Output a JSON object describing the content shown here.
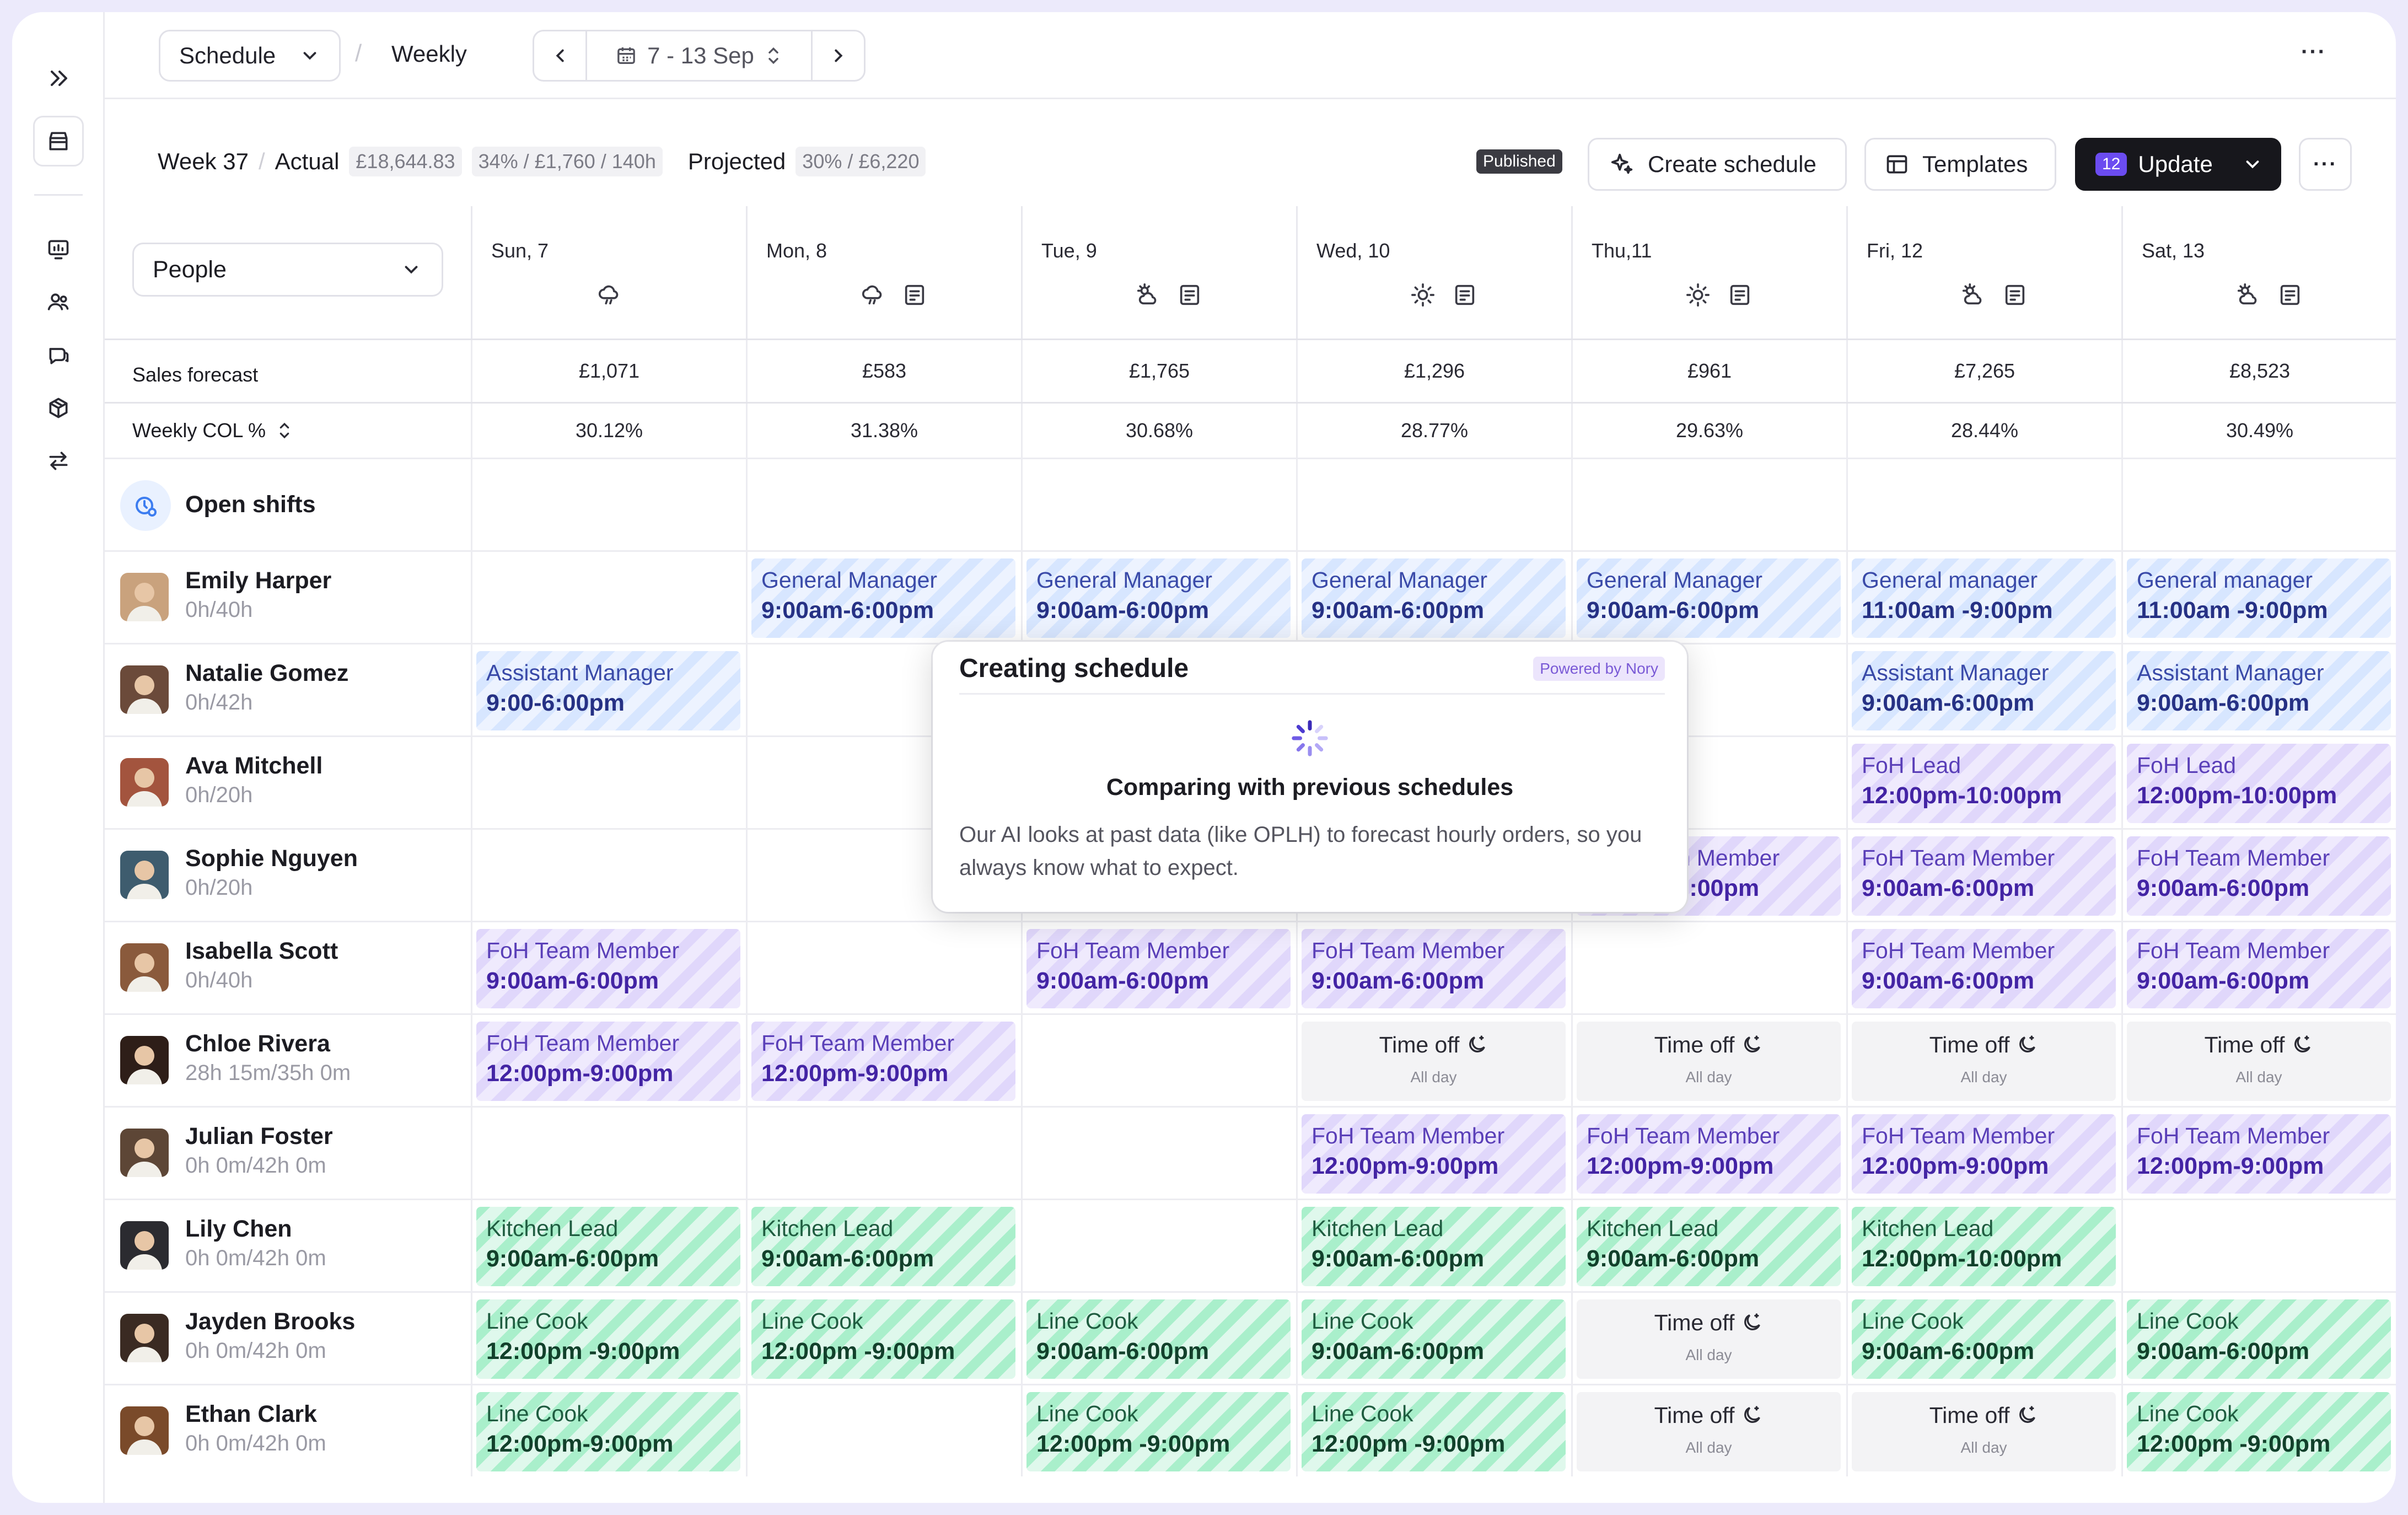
{
  "toolbar": {
    "schedule_label": "Schedule",
    "view_label": "Weekly",
    "date_range": "7 - 13 Sep",
    "more_label": "···"
  },
  "summary": {
    "week": "Week 37",
    "actual_label": "Actual",
    "actual_amount": "£18,644.83",
    "actual_stats": "34% / £1,760 / 140h",
    "projected_label": "Projected",
    "projected_stats": "30% / £6,220",
    "status_badge": "Published",
    "create_label": "Create schedule",
    "templates_label": "Templates",
    "update_count": "12",
    "update_label": "Update",
    "more_label": "···"
  },
  "filter": {
    "selected": "People"
  },
  "days": [
    {
      "label": "Sun, 7",
      "icons": [
        "cloud-rain-icon"
      ]
    },
    {
      "label": "Mon, 8",
      "icons": [
        "cloud-rain-icon",
        "note-icon"
      ]
    },
    {
      "label": "Tue, 9",
      "icons": [
        "cloud-sun-icon",
        "note-icon"
      ]
    },
    {
      "label": "Wed, 10",
      "icons": [
        "sun-icon",
        "note-icon"
      ]
    },
    {
      "label": "Thu,11",
      "icons": [
        "sun-icon",
        "note-icon"
      ]
    },
    {
      "label": "Fri, 12",
      "icons": [
        "cloud-sun-icon",
        "note-icon"
      ]
    },
    {
      "label": "Sat, 13",
      "icons": [
        "cloud-sun-icon",
        "note-icon"
      ]
    }
  ],
  "metrics": {
    "sales_label": "Sales forecast",
    "sales": [
      "£1,071",
      "£583",
      "£1,765",
      "£1,296",
      "£961",
      "£7,265",
      "£8,523"
    ],
    "col_label": "Weekly COL %",
    "col": [
      "30.12%",
      "31.38%",
      "30.68%",
      "28.77%",
      "29.63%",
      "28.44%",
      "30.49%"
    ]
  },
  "open_shifts_label": "Open shifts",
  "people": [
    {
      "name": "Emily Harper",
      "hours": "0h/40h",
      "avatar_color": "#c9a27d",
      "shifts": [
        null,
        {
          "type": "blue",
          "role": "General Manager",
          "time": "9:00am-6:00pm"
        },
        {
          "type": "blue",
          "role": "General Manager",
          "time": "9:00am-6:00pm"
        },
        {
          "type": "blue",
          "role": "General Manager",
          "time": "9:00am-6:00pm"
        },
        {
          "type": "blue",
          "role": "General Manager",
          "time": "9:00am-6:00pm"
        },
        {
          "type": "blue",
          "role": "General manager",
          "time": "11:00am -9:00pm"
        },
        {
          "type": "blue",
          "role": "General manager",
          "time": "11:00am -9:00pm"
        }
      ]
    },
    {
      "name": "Natalie Gomez",
      "hours": "0h/42h",
      "avatar_color": "#6b4a3a",
      "shifts": [
        {
          "type": "blue",
          "role": "Assistant Manager",
          "time": "9:00-6:00pm"
        },
        null,
        null,
        null,
        null,
        {
          "type": "blue",
          "role": "Assistant Manager",
          "time": "9:00am-6:00pm"
        },
        {
          "type": "blue",
          "role": "Assistant Manager",
          "time": "9:00am-6:00pm"
        }
      ]
    },
    {
      "name": "Ava Mitchell",
      "hours": "0h/20h",
      "avatar_color": "#a3543e",
      "shifts": [
        null,
        null,
        null,
        null,
        null,
        {
          "type": "purple",
          "role": "FoH Lead",
          "time": "12:00pm-10:00pm"
        },
        {
          "type": "purple",
          "role": "FoH Lead",
          "time": "12:00pm-10:00pm"
        }
      ]
    },
    {
      "name": "Sophie Nguyen",
      "hours": "0h/20h",
      "avatar_color": "#3e5c6e",
      "shifts": [
        null,
        null,
        null,
        null,
        {
          "type": "purple",
          "role": "FoH Team Member",
          "time": "9:00am-6:00pm"
        },
        {
          "type": "purple",
          "role": "FoH Team Member",
          "time": "9:00am-6:00pm"
        },
        {
          "type": "purple",
          "role": "FoH Team Member",
          "time": "9:00am-6:00pm"
        }
      ]
    },
    {
      "name": "Isabella Scott",
      "hours": "0h/40h",
      "avatar_color": "#8a5a3c",
      "shifts": [
        {
          "type": "purple",
          "role": "FoH Team Member",
          "time": "9:00am-6:00pm"
        },
        null,
        {
          "type": "purple",
          "role": "FoH Team Member",
          "time": "9:00am-6:00pm"
        },
        {
          "type": "purple",
          "role": "FoH Team Member",
          "time": "9:00am-6:00pm"
        },
        null,
        {
          "type": "purple",
          "role": "FoH Team Member",
          "time": "9:00am-6:00pm"
        },
        {
          "type": "purple",
          "role": "FoH Team Member",
          "time": "9:00am-6:00pm"
        }
      ]
    },
    {
      "name": "Chloe Rivera",
      "hours": "28h 15m/35h 0m",
      "avatar_color": "#2e1e18",
      "shifts": [
        {
          "type": "purple",
          "role": "FoH Team Member",
          "time": "12:00pm-9:00pm"
        },
        {
          "type": "purple",
          "role": "FoH Team Member",
          "time": "12:00pm-9:00pm"
        },
        null,
        {
          "type": "off",
          "role": "Time off",
          "time": "All day"
        },
        {
          "type": "off",
          "role": "Time off",
          "time": "All day"
        },
        {
          "type": "off",
          "role": "Time off",
          "time": "All day"
        },
        {
          "type": "off",
          "role": "Time off",
          "time": "All day"
        }
      ]
    },
    {
      "name": "Julian Foster",
      "hours": "0h 0m/42h 0m",
      "avatar_color": "#5d4636",
      "shifts": [
        null,
        null,
        null,
        {
          "type": "purple",
          "role": "FoH Team Member",
          "time": "12:00pm-9:00pm"
        },
        {
          "type": "purple",
          "role": "FoH Team Member",
          "time": "12:00pm-9:00pm"
        },
        {
          "type": "purple",
          "role": "FoH Team Member",
          "time": "12:00pm-9:00pm"
        },
        {
          "type": "purple",
          "role": "FoH Team Member",
          "time": "12:00pm-9:00pm"
        }
      ]
    },
    {
      "name": "Lily Chen",
      "hours": "0h 0m/42h 0m",
      "avatar_color": "#2b2b30",
      "shifts": [
        {
          "type": "green",
          "role": "Kitchen Lead",
          "time": "9:00am-6:00pm"
        },
        {
          "type": "green",
          "role": "Kitchen Lead",
          "time": "9:00am-6:00pm"
        },
        null,
        {
          "type": "green",
          "role": "Kitchen Lead",
          "time": "9:00am-6:00pm"
        },
        {
          "type": "green",
          "role": "Kitchen Lead",
          "time": "9:00am-6:00pm"
        },
        {
          "type": "green",
          "role": "Kitchen Lead",
          "time": "12:00pm-10:00pm"
        },
        null
      ]
    },
    {
      "name": "Jayden Brooks",
      "hours": "0h 0m/42h 0m",
      "avatar_color": "#3a2a22",
      "shifts": [
        {
          "type": "green",
          "role": "Line Cook",
          "time": "12:00pm -9:00pm"
        },
        {
          "type": "green",
          "role": "Line Cook",
          "time": "12:00pm -9:00pm"
        },
        {
          "type": "green",
          "role": "Line Cook",
          "time": "9:00am-6:00pm"
        },
        {
          "type": "green",
          "role": "Line Cook",
          "time": "9:00am-6:00pm"
        },
        {
          "type": "off",
          "role": "Time off",
          "time": "All day"
        },
        {
          "type": "green",
          "role": "Line Cook",
          "time": "9:00am-6:00pm"
        },
        {
          "type": "green",
          "role": "Line Cook",
          "time": "9:00am-6:00pm"
        }
      ]
    },
    {
      "name": "Ethan Clark",
      "hours": "0h 0m/42h 0m",
      "avatar_color": "#7a4a2a",
      "shifts": [
        {
          "type": "green",
          "role": "Line Cook",
          "time": "12:00pm-9:00pm"
        },
        null,
        {
          "type": "green",
          "role": "Line Cook",
          "time": "12:00pm -9:00pm"
        },
        {
          "type": "green",
          "role": "Line Cook",
          "time": "12:00pm -9:00pm"
        },
        {
          "type": "off",
          "role": "Time off",
          "time": "All day"
        },
        {
          "type": "off",
          "role": "Time off",
          "time": "All day"
        },
        {
          "type": "green",
          "role": "Line Cook",
          "time": "12:00pm -9:00pm"
        }
      ]
    }
  ],
  "modal": {
    "title": "Creating schedule",
    "badge": "Powered by Nory",
    "heading": "Comparing with previous schedules",
    "body": "Our AI looks at past data (like OPLH) to forecast hourly orders, so you always know what to expect."
  }
}
